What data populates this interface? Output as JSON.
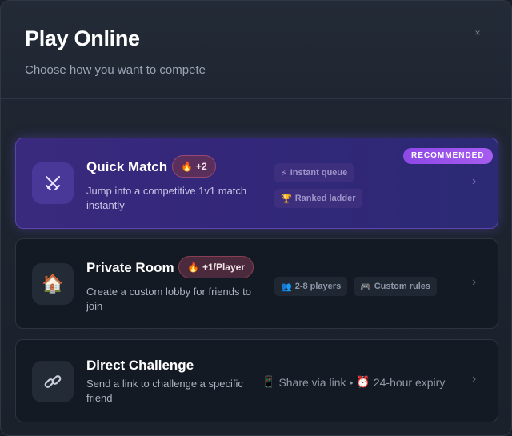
{
  "modal": {
    "title": "Play Online",
    "subtitle": "Choose how you want to compete",
    "close_glyph": "×"
  },
  "cards": [
    {
      "id": "quick-match",
      "title": "Quick Match",
      "description": "Jump into a competitive 1v1 match instantly",
      "bonus": {
        "emoji": "🔥",
        "label": "+2"
      },
      "badge": "RECOMMENDED",
      "tags": [
        {
          "emoji": "⚡",
          "label": "Instant queue"
        },
        {
          "emoji": "🏆",
          "label": "Ranked ladder"
        }
      ],
      "icon": "crossed-swords-icon"
    },
    {
      "id": "private-room",
      "title": "Private Room",
      "description": "Create a custom lobby for friends to join",
      "bonus": {
        "emoji": "🔥",
        "label": "+1/Player"
      },
      "tags": [
        {
          "emoji": "👥",
          "label": "2-8 players"
        },
        {
          "emoji": "🎮",
          "label": "Custom rules"
        }
      ],
      "icon": "house-icon",
      "icon_glyph": "🏠"
    },
    {
      "id": "direct-challenge",
      "title": "Direct Challenge",
      "description": "Send a link to challenge a specific friend",
      "meta": {
        "share_emoji": "📱",
        "share_label": "Share via link",
        "separator": "•",
        "expiry_emoji": "⏰",
        "expiry_label": "24-hour expiry"
      },
      "icon": "link-icon"
    }
  ],
  "chevron_glyph": "›",
  "colors": {
    "accent": "#8c48e6",
    "featured_bg": "#33277a",
    "card_bg": "#141a23"
  }
}
